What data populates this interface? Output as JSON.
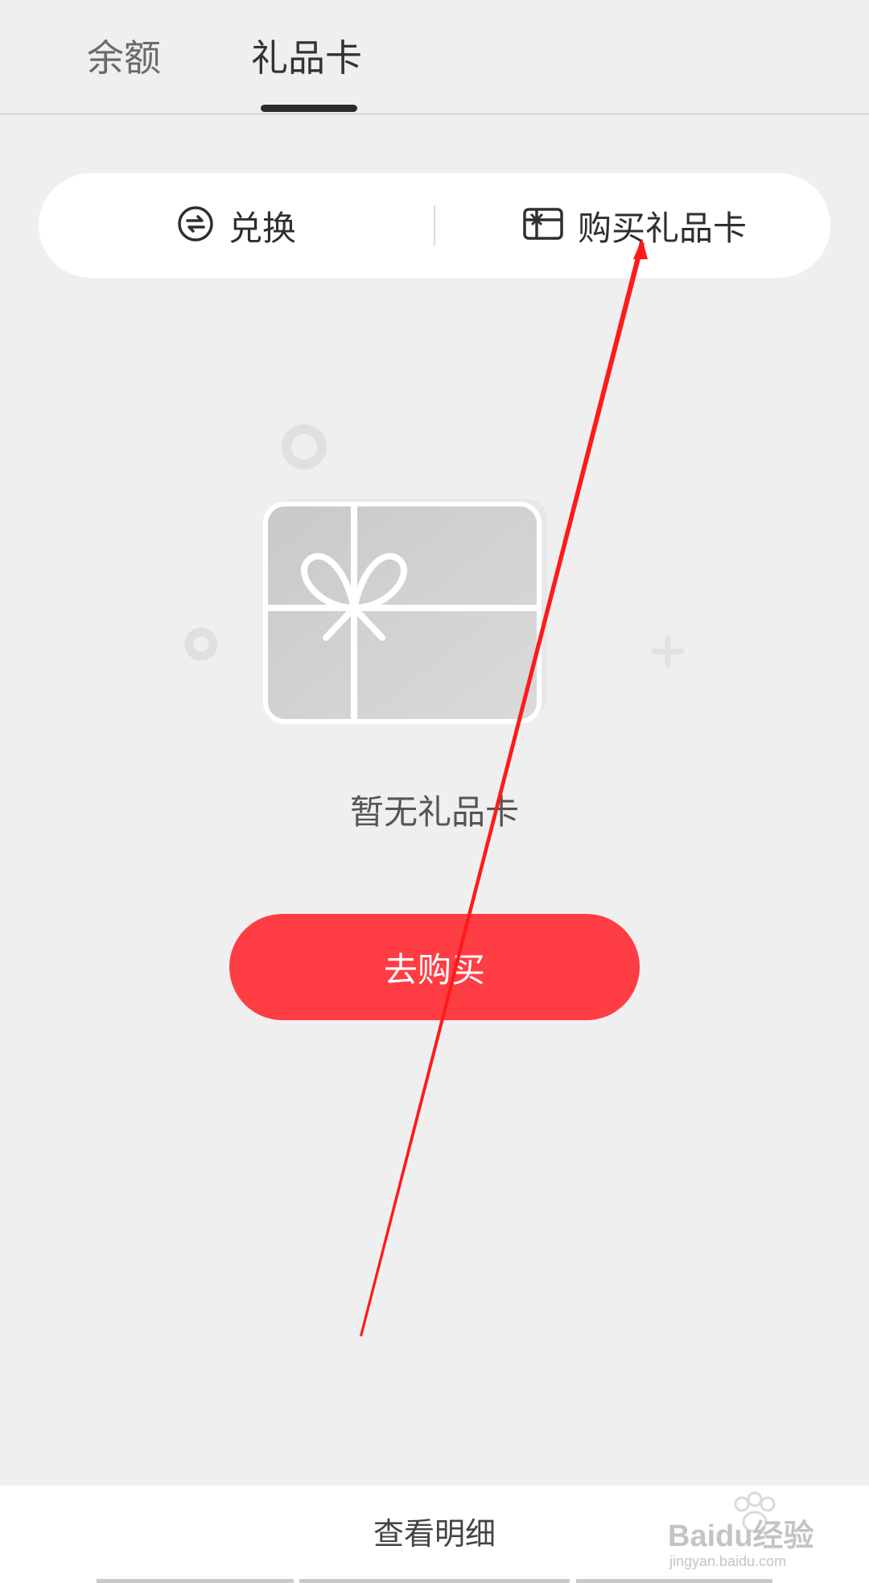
{
  "tabs": [
    {
      "label": "余额",
      "active": false
    },
    {
      "label": "礼品卡",
      "active": true
    }
  ],
  "actions": {
    "redeem_label": "兑换",
    "redeem_icon": "exchange-icon",
    "buy_label": "购买礼品卡",
    "buy_icon": "gift-card-icon"
  },
  "empty_state": {
    "message": "暂无礼品卡",
    "illustration": "gift-card-illustration"
  },
  "buy_button": {
    "label": "去购买"
  },
  "footer": {
    "detail_label": "查看明细"
  },
  "watermark": {
    "text": "Baidu经验",
    "subtext": "jingyan.baidu.com"
  },
  "colors": {
    "accent": "#ff3d44",
    "annotation_arrow": "#ff1a1a",
    "background": "#f0eff0"
  }
}
